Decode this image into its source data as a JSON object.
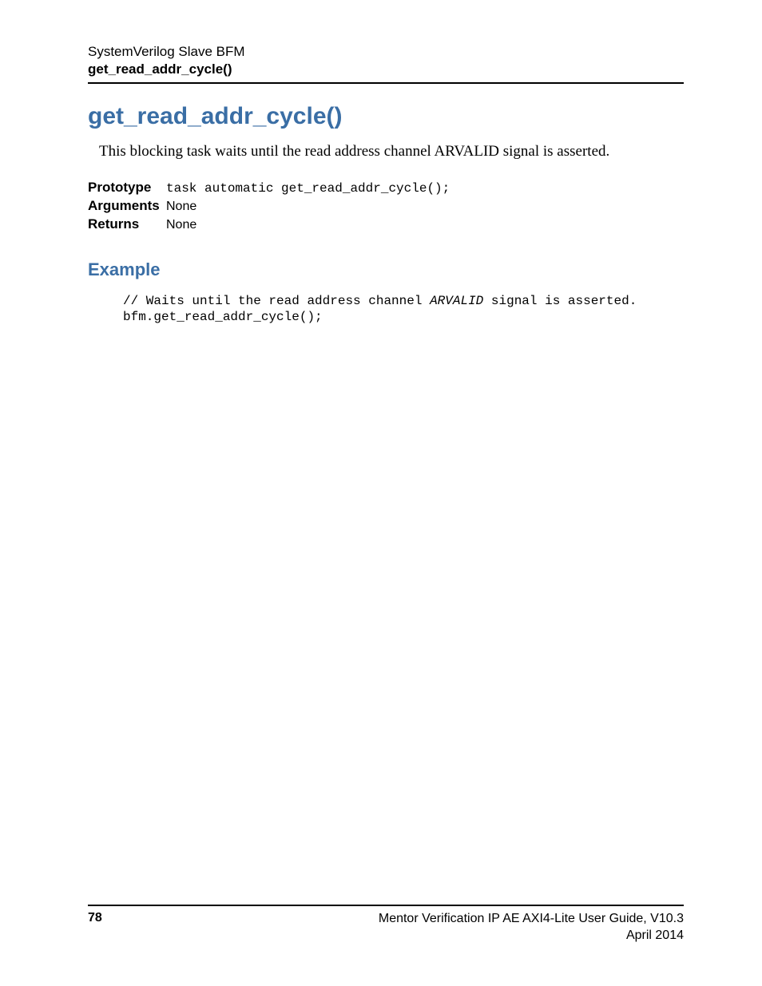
{
  "header": {
    "line1": "SystemVerilog Slave BFM",
    "line2": "get_read_addr_cycle()"
  },
  "title": "get_read_addr_cycle()",
  "description": "This blocking task waits until the read address channel ARVALID signal is asserted.",
  "definitions": {
    "prototype_label": "Prototype",
    "prototype_value": "task automatic get_read_addr_cycle();",
    "arguments_label": "Arguments",
    "arguments_value": "None",
    "returns_label": "Returns",
    "returns_value": "None"
  },
  "example": {
    "heading": "Example",
    "code_comment_prefix": "// Waits until the read address channel ",
    "code_comment_italic": "ARVALID",
    "code_comment_suffix": " signal is asserted.",
    "code_line2": "bfm.get_read_addr_cycle();"
  },
  "footer": {
    "page_number": "78",
    "doc_title": "Mentor Verification IP AE AXI4-Lite User Guide, V10.3",
    "date": "April 2014"
  }
}
